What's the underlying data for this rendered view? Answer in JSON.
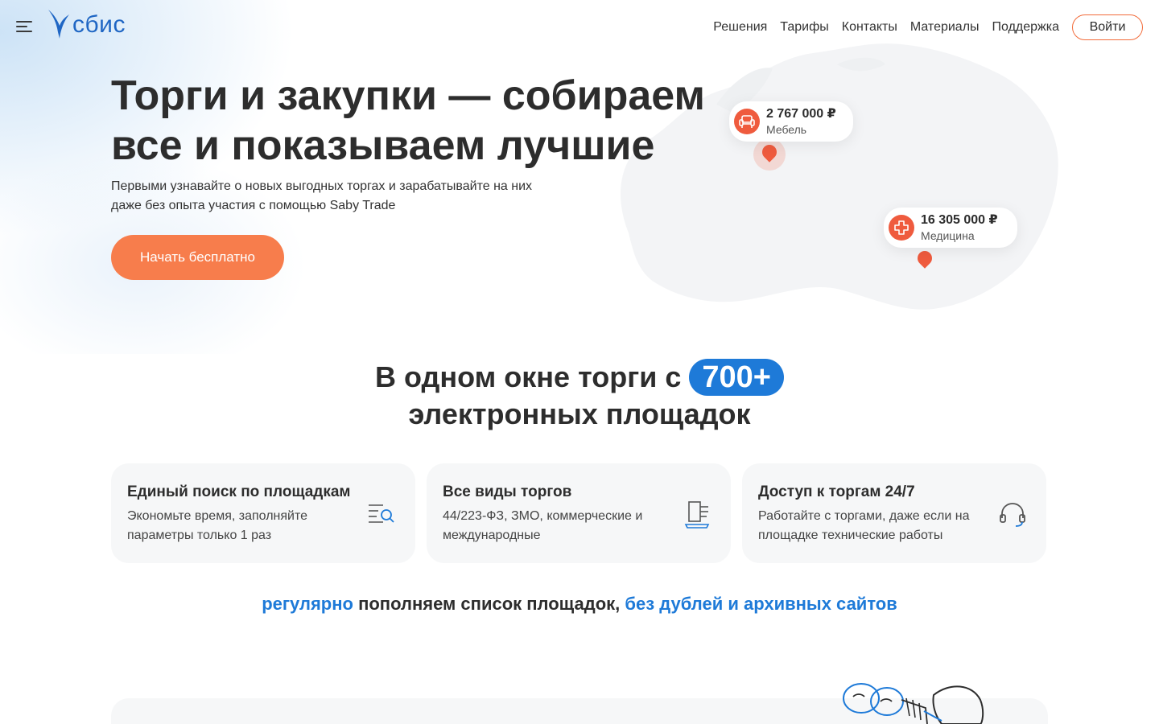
{
  "header": {
    "logo_text": "сбис",
    "nav": [
      "Решения",
      "Тарифы",
      "Контакты",
      "Материалы",
      "Поддержка"
    ],
    "login_label": "Войти"
  },
  "hero": {
    "title": "Торги и закупки — собираем все и показываем лучшие",
    "subtitle_line1": "Первыми узнавайте о новых выгодных торгах и зарабатывайте на них",
    "subtitle_line2": "даже без опыта участия с помощью Saby Trade",
    "cta_label": "Начать бесплатно"
  },
  "map_pins": [
    {
      "amount": "2 767 000 ₽",
      "category": "Мебель",
      "icon": "armchair-icon"
    },
    {
      "amount": "16 305 000 ₽",
      "category": "Медицина",
      "icon": "medical-cross-icon"
    }
  ],
  "platforms": {
    "title_prefix": "В одном окне торги с",
    "badge": "700+",
    "title_suffix": "электронных площадок"
  },
  "features": [
    {
      "title": "Единый поиск по площадкам",
      "desc": "Экономьте время, заполняйте параметры только 1 раз",
      "icon": "search-list-icon"
    },
    {
      "title": "Все виды торгов",
      "desc": "44/223-ФЗ, ЗМО, коммерческие и международные",
      "icon": "document-stack-icon"
    },
    {
      "title": "Доступ к торгам 24/7",
      "desc": "Работайте с торгами, даже если на площадке технические работы",
      "icon": "headset-icon"
    }
  ],
  "tagline": {
    "part1": "регулярно",
    "part2": " пополняем список площадок, ",
    "part3": "без дублей и архивных сайтов"
  },
  "colors": {
    "accent_orange": "#f77d4c",
    "brand_blue": "#1e7ad8",
    "pin_red": "#ef5b3e"
  }
}
